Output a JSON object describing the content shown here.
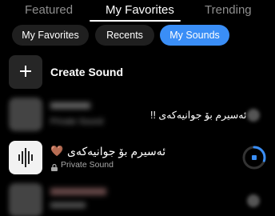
{
  "top_tabs": {
    "featured": "Featured",
    "my_favorites": "My Favorites",
    "trending": "Trending"
  },
  "chips": {
    "my_favorites": "My Favorites",
    "recents": "Recents",
    "my_sounds": "My Sounds"
  },
  "create_sound": {
    "label": "Create Sound"
  },
  "sounds": [
    {
      "title": "ئەسیرم بۆ جوانیەکەی !!",
      "subtitle": "Private Sound",
      "blurred": true
    },
    {
      "title": "ئەسیرم بۆ جوانیەکەی",
      "emoji": "🤎",
      "subtitle": "Private Sound",
      "blurred": false,
      "progress": 0.3
    },
    {
      "title": "",
      "subtitle": "",
      "blurred": true
    }
  ],
  "colors": {
    "accent": "#3a8ef6",
    "background": "#000000",
    "chip_bg": "#1f1f1f",
    "emoji_brown": "#8b5a3c"
  },
  "icons": {
    "create": "plus-icon",
    "lock": "lock-icon",
    "waveform": "waveform-icon"
  }
}
